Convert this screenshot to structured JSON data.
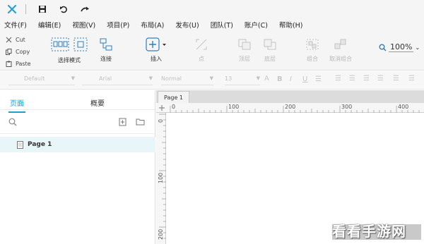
{
  "titlebar": {
    "icons": [
      "axure-logo-icon",
      "save-icon",
      "undo-icon",
      "redo-icon"
    ]
  },
  "menu": [
    "文件(F)",
    "编辑(E)",
    "视图(V)",
    "项目(P)",
    "布局(A)",
    "发布(U)",
    "团队(T)",
    "账户(C)",
    "帮助(H)"
  ],
  "clipboard": {
    "cut": "Cut",
    "copy": "Copy",
    "paste": "Paste"
  },
  "toolbar": {
    "select_mode": "选择模式",
    "connect": "连接",
    "insert": "插入",
    "point": "点",
    "top": "顶层",
    "bottom": "底层",
    "group": "组合",
    "ungroup": "取消组合",
    "zoom": "100%"
  },
  "format": {
    "style": "Default",
    "font": "Arial",
    "weight": "Normal",
    "size": "13"
  },
  "panel": {
    "tab_pages": "页面",
    "tab_outline": "概要",
    "page_item": "Page 1"
  },
  "canvas": {
    "tab": "Page 1",
    "ruler_h": [
      "0",
      "100",
      "200",
      "300",
      "400"
    ],
    "ruler_v": [
      "0",
      "100",
      "200"
    ]
  },
  "watermark": "看看手游网",
  "colors": {
    "accent": "#1ba0c8",
    "logo": "#2a9fd6"
  }
}
